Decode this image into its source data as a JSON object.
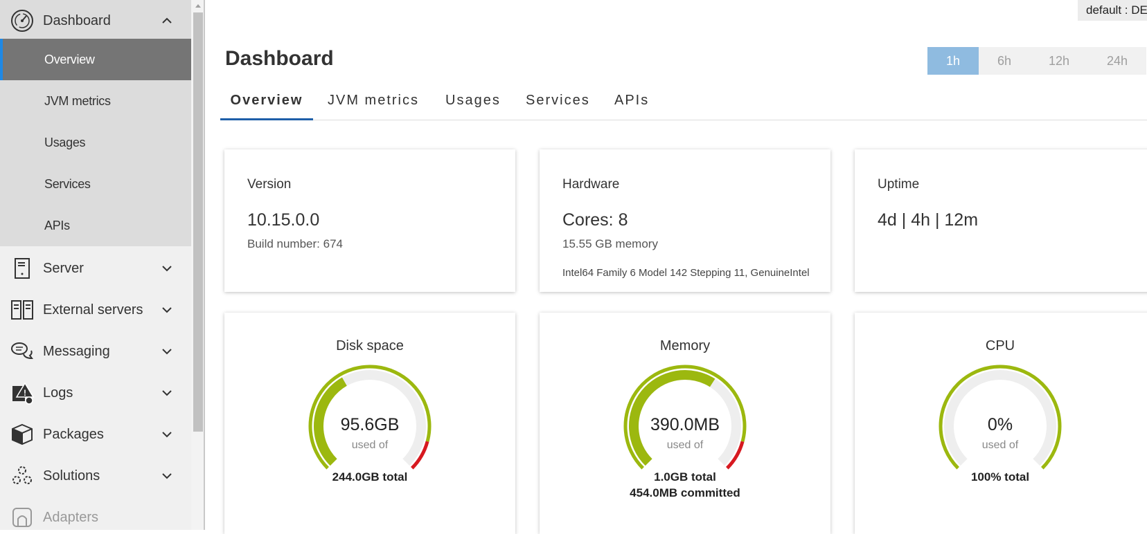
{
  "sidebar": {
    "dashboard_label": "Dashboard",
    "sub_items": [
      "Overview",
      "JVM metrics",
      "Usages",
      "Services",
      "APIs"
    ],
    "groups": [
      {
        "label": "Server",
        "icon": "server-icon"
      },
      {
        "label": "External servers",
        "icon": "external-servers-icon"
      },
      {
        "label": "Messaging",
        "icon": "messaging-icon"
      },
      {
        "label": "Logs",
        "icon": "logs-icon"
      },
      {
        "label": "Packages",
        "icon": "packages-icon"
      },
      {
        "label": "Solutions",
        "icon": "solutions-icon"
      },
      {
        "label": "Adapters",
        "icon": "adapters-icon"
      }
    ]
  },
  "header": {
    "tenant": "default : DE",
    "title": "Dashboard",
    "ranges": [
      "1h",
      "6h",
      "12h",
      "24h"
    ],
    "selected_range": "1h"
  },
  "tabs": [
    "Overview",
    "JVM metrics",
    "Usages",
    "Services",
    "APIs"
  ],
  "cards": {
    "version": {
      "title": "Version",
      "value": "10.15.0.0",
      "sub": "Build number: 674"
    },
    "hardware": {
      "title": "Hardware",
      "value": "Cores: 8",
      "sub": "15.55 GB memory",
      "detail": "Intel64 Family 6 Model 142 Stepping 11, GenuineIntel"
    },
    "uptime": {
      "title": "Uptime",
      "value": "4d | 4h | 12m"
    }
  },
  "gauges": {
    "disk": {
      "title": "Disk space",
      "value": "95.6GB",
      "unit": "used of",
      "total": "244.0GB total",
      "used_fraction": 0.39
    },
    "memory": {
      "title": "Memory",
      "value": "390.0MB",
      "unit": "used of",
      "total": "1.0GB total",
      "extra": "454.0MB committed",
      "used_fraction": 0.62
    },
    "cpu": {
      "title": "CPU",
      "value": "0%",
      "unit": "used of",
      "total": "100% total",
      "used_fraction": 0.0
    }
  },
  "colors": {
    "accent": "#1e88e5",
    "gauge_green": "#9cb80f",
    "gauge_red": "#d71920",
    "gauge_track": "#eeeeee",
    "range_selected": "#8fbbe0"
  }
}
